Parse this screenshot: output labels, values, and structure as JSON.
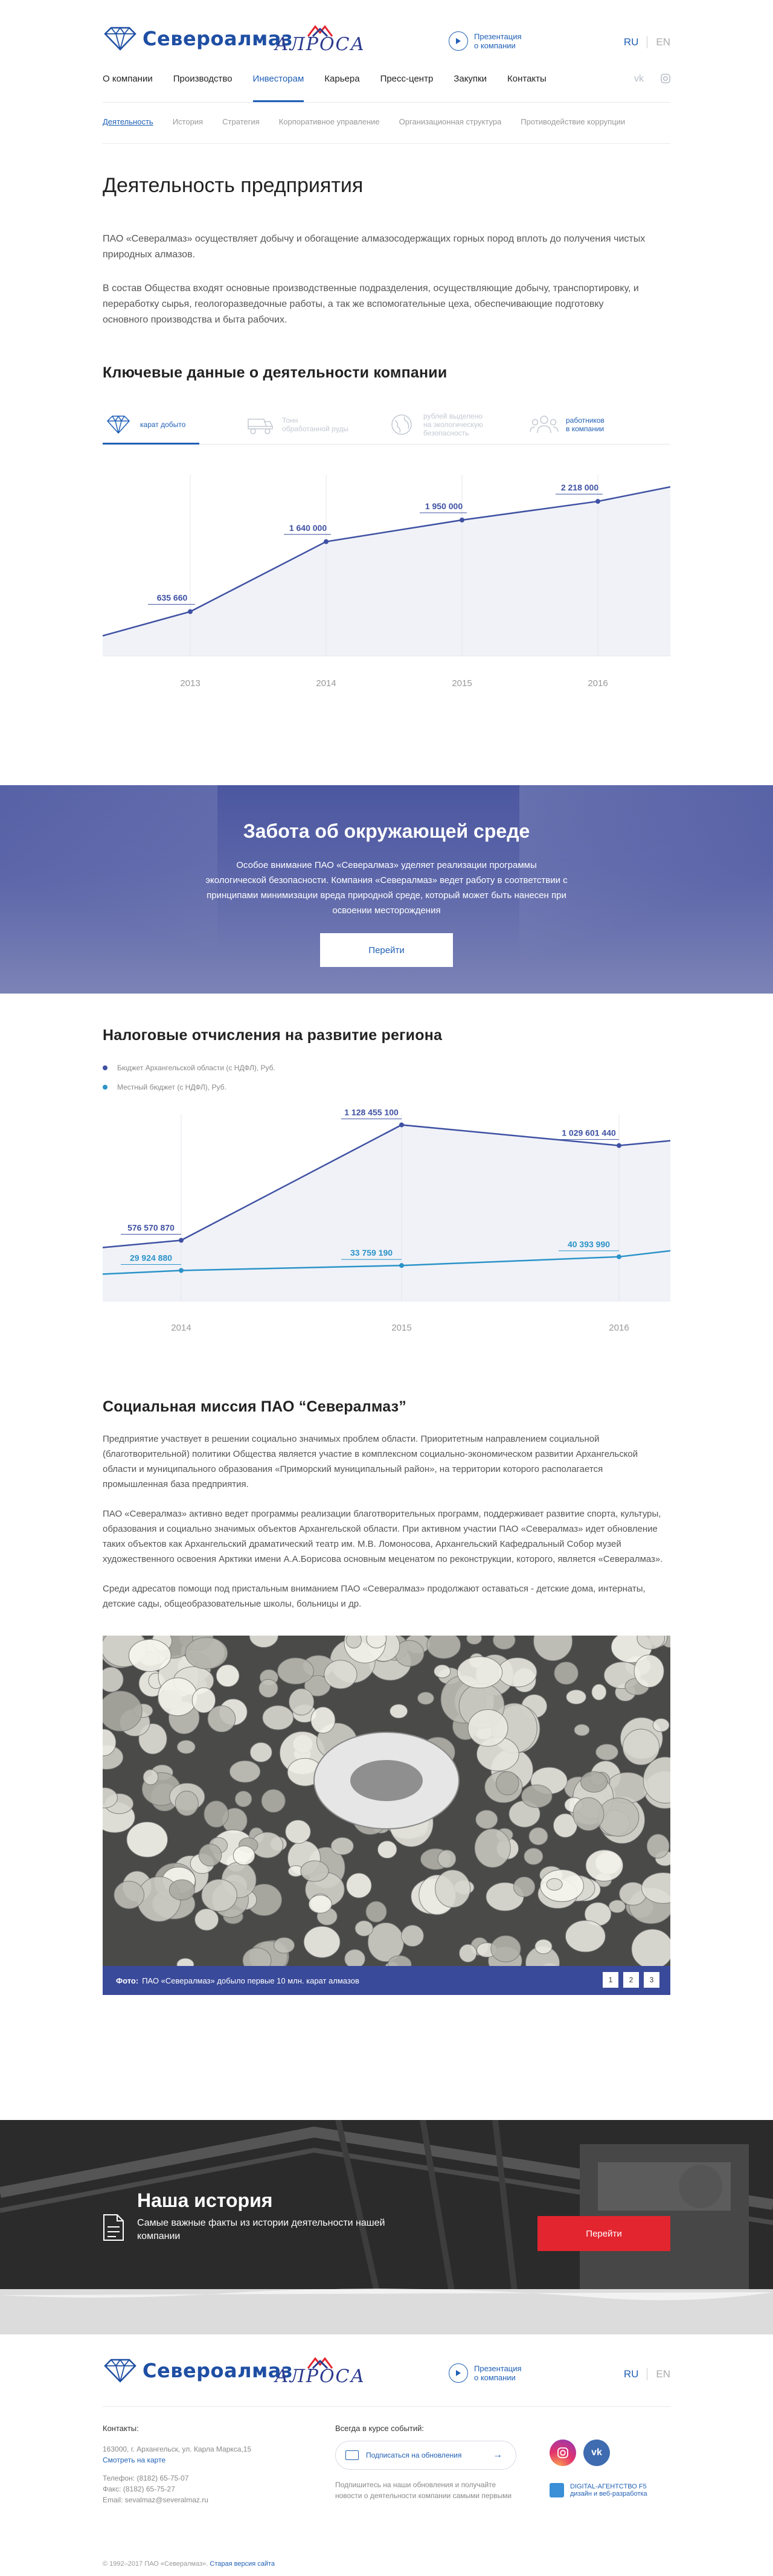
{
  "header": {
    "logo_text": "Североалмаз",
    "alrosa_text": "АЛРОСА",
    "presentation_line1": "Презентация",
    "presentation_line2": "о компании",
    "lang_ru": "RU",
    "lang_en": "EN"
  },
  "nav": {
    "items": [
      "О компании",
      "Производство",
      "Инвесторам",
      "Карьера",
      "Пресс-центр",
      "Закупки",
      "Контакты"
    ],
    "active_index": 2
  },
  "subnav": {
    "items": [
      "Деятельность",
      "История",
      "Стратегия",
      "Корпоративное управление",
      "Организационная структура",
      "Противодействие коррупции"
    ],
    "active_index": 0
  },
  "page": {
    "title": "Деятельность предприятия",
    "p1": "ПАО «Севералмаз» осуществляет добычу и обогащение алмазосодержащих горных пород вплоть до получения чистых природных алмазов.",
    "p2": "В состав Общества входят основные производственные подразделения, осуществляющие добычу, транспортировку, и переработку сырья, геологоразведочные работы, а так же вспомогательные цеха, обеспечивающие подготовку основного производства и быта рабочих."
  },
  "key_data": {
    "title": "Ключевые данные о деятельности компании",
    "tabs": [
      {
        "label1": "карат добыто",
        "label2": "",
        "icon": "diamond-icon"
      },
      {
        "label1": "Тонн",
        "label2": "обработанной руды",
        "icon": "dump-truck-icon"
      },
      {
        "label1": "рублей выделено",
        "label2": "на экологическую безопасность",
        "icon": "globe-icon"
      },
      {
        "label1": "работников",
        "label2": "в компании",
        "icon": "people-icon"
      }
    ]
  },
  "chart_data": [
    {
      "type": "area",
      "title": "",
      "x": [
        "2013",
        "2014",
        "2015",
        "2016"
      ],
      "series": [
        {
          "name": "",
          "values": [
            635660,
            1640000,
            1950000,
            2218000
          ]
        }
      ],
      "labels": [
        "635 660",
        "1 640 000",
        "1 950 000",
        "2 218 000"
      ],
      "ylim": [
        0,
        2600000
      ],
      "color": "#3f51a3"
    },
    {
      "type": "line",
      "title": "Налоговые отчисления на развитие региона",
      "x": [
        "2014",
        "2015",
        "2016"
      ],
      "series": [
        {
          "name": "Бюджет Архангельской области (с НДФЛ), Руб.",
          "values": [
            576570870,
            1128455100,
            1029601440
          ],
          "labels": [
            "576 570 870",
            "1 128 455 100",
            "1 029 601 440"
          ],
          "color": "#3f51a3"
        },
        {
          "name": "Местный бюджет (с НДФЛ), Руб.",
          "values": [
            29924880,
            33759190,
            40393990
          ],
          "labels": [
            "29 924 880",
            "33 759 190",
            "40 393 990"
          ],
          "color": "#2b93c8"
        }
      ],
      "legend": "top-left"
    }
  ],
  "environment": {
    "title": "Забота об окружающей среде",
    "text": "Особое внимание ПАО «Севералмаз» уделяет реализации программы экологической безопасности. Компания «Севералмаз» ведет работу в соответствии с принципами минимизации вреда природной среде, который может быть нанесен при освоении месторождения",
    "button": "Перейти"
  },
  "tax": {
    "title": "Налоговые отчисления на развитие региона",
    "legend1": "Бюджет Архангельской области (с НДФЛ), Руб.",
    "legend2": "Местный бюджет (с НДФЛ), Руб."
  },
  "social": {
    "title": "Социальная миссия ПАО “Севералмаз”",
    "p1": "Предприятие участвует в решении социально значимых проблем области. Приоритетным направлением социальной (благотворительной) политики Общества является участие в комплексном социально-экономическом развитии Архангельской области и муниципального образования «Приморский муниципальный район», на территории которого располагается промышленная база предприятия.",
    "p2": "ПАО «Севералмаз» активно ведет программы реализации благотворительных программ, поддерживает развитие спорта, культуры, образования и социально значимых объектов Архангельской области. При активном участии ПАО «Севералмаз» идет обновление таких объектов как Архангельский драматический театр им. М.В. Ломоносова, Архангельский Кафедральный Собор музей художественного освоения Арктики имени А.А.Борисова основным меценатом по реконструкции, которого, является «Севералмаз».",
    "p3": "Среди адресатов помощи под пристальным вниманием ПАО «Севералмаз» продолжают оставаться -   детские дома, интернаты, детские сады, общеобразовательные школы, больницы и др."
  },
  "gallery": {
    "caption_bold": "Фото:",
    "caption": "ПАО «Севералмаз» добыло первые 10 млн. карат алмазов",
    "pages": [
      "1",
      "2",
      "3"
    ]
  },
  "history": {
    "title": "Наша история",
    "text": "Самые важные факты из истории деятельности нашей компании",
    "button": "Перейти"
  },
  "footer": {
    "contacts_label": "Контакты:",
    "address": "163000, г. Архангельск, ул. Карла Маркса,15",
    "map_link": "Смотреть на карте",
    "phone": "Телефон: (8182) 65-75-07",
    "fax": "Факс: (8182) 65-75-27",
    "email": "Email: sevalmaz@severalmaz.ru",
    "news_label": "Всегда в курсе событий:",
    "subscribe": "Подписаться на обновления",
    "subscribe_note": "Подпишитесь на наши обновления и получайте новости о деятельности компании самыми первыми",
    "agency_name": "DIGITAL-АГЕНТСТВО F5",
    "agency_sub": "дизайн и веб-разработка",
    "copyright": "© 1992–2017 ПАО «Севералмаз».",
    "old_version": "Старая версия сайта"
  },
  "colors": {
    "brand_blue": "#1f5fb5",
    "chart_blue": "#3f51a3",
    "chart_cyan": "#2b93c8",
    "history_red": "#e3252f"
  }
}
